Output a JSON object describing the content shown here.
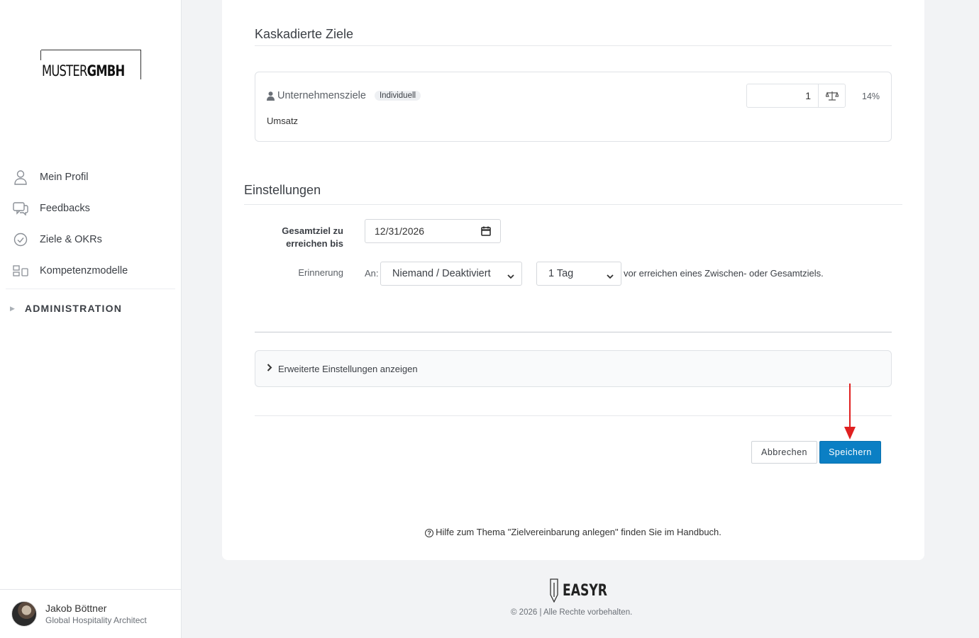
{
  "brand": {
    "logo_light": "MUSTER",
    "logo_bold": "GMBH"
  },
  "sidebar": {
    "items": [
      {
        "label": "Mein Profil",
        "icon": "user-icon"
      },
      {
        "label": "Feedbacks",
        "icon": "chat-icon"
      },
      {
        "label": "Ziele & OKRs",
        "icon": "check-circle-icon"
      },
      {
        "label": "Kompetenzmodelle",
        "icon": "grid-icon"
      }
    ],
    "admin_label": "ADMINISTRATION"
  },
  "user": {
    "name": "Jakob Böttner",
    "role": "Global Hospitality Architect"
  },
  "cascaded": {
    "title": "Kaskadierte Ziele",
    "goal_name": "Unternehmensziele",
    "badge": "Individuell",
    "subtitle": "Umsatz",
    "weight_value": "1",
    "percent": "14%"
  },
  "settings": {
    "title": "Einstellungen",
    "target_label_line1": "Gesamtziel zu",
    "target_label_line2": "erreichen bis",
    "target_date": "12/31/2026",
    "reminder_label": "Erinnerung",
    "an_label": "An:",
    "recipient": "Niemand / Deaktiviert",
    "interval": "1 Tag",
    "reminder_text": "vor erreichen eines Zwischen- oder Gesamtziels."
  },
  "advanced_label": "Erweiterte Einstellungen anzeigen",
  "buttons": {
    "cancel": "Abbrechen",
    "save": "Speichern"
  },
  "help_text": "Hilfe zum Thema \"Zielvereinbarung anlegen\" finden Sie im Handbuch.",
  "footer": {
    "logo_text": "EASYR",
    "copyright": "© 2026 | Alle Rechte vorbehalten."
  },
  "colors": {
    "primary": "#0b7fc4",
    "arrow": "#e02020"
  }
}
